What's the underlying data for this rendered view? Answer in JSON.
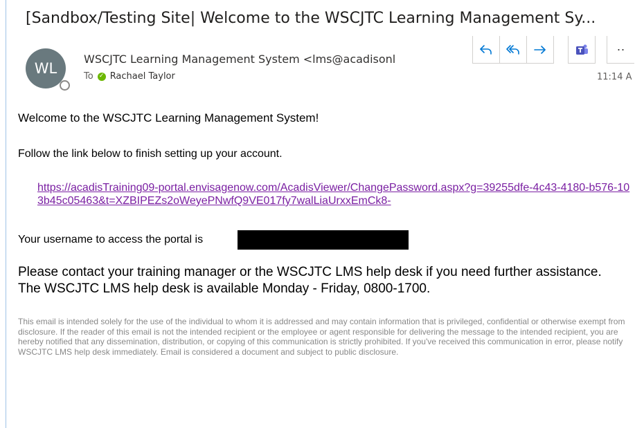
{
  "email": {
    "subject": "[Sandbox/Testing Site| Welcome to the WSCJTC Learning Management Sy...",
    "sender": {
      "initials": "WL",
      "display": "WSCJTC Learning Management System <lms@acadisonl"
    },
    "to_label": "To",
    "recipient": "Rachael Taylor",
    "time": "11:14 A",
    "actions": {
      "reply_icon": "reply-icon",
      "reply_all_icon": "reply-all-icon",
      "forward_icon": "forward-icon",
      "teams_icon": "teams-icon",
      "more_label": "··"
    },
    "body": {
      "welcome": "Welcome to the WSCJTC Learning Management System!",
      "follow": "Follow the link below to finish setting up your account.",
      "link": "https://acadisTraining09-portal.envisagenow.com/AcadisViewer/ChangePassword.aspx?g=39255dfe-4c43-4180-b576-103b45c05463&t=XZBIPEZs2oWeyePNwfQ9VE017fy7walLiaUrxxEmCk8-",
      "username_prefix": "Your username to access the portal is",
      "contact": "Please contact your training manager or the WSCJTC LMS help desk if you need further assistance. The WSCJTC LMS help desk is available Monday - Friday, 0800-1700.",
      "disclaimer": "This email is intended solely for the use of the individual to whom it is addressed and may contain information that is privileged, confidential or otherwise exempt from disclosure. If the reader of this email is not the intended recipient or the employee or agent responsible for delivering the message to the intended recipient, you are hereby notified that any dissemination, distribution, or copying of this communication is strictly prohibited. If you've received this communication in error, please notify WSCJTC LMS help desk immediately. Email is considered a document and subject to public disclosure."
    }
  },
  "colors": {
    "avatar_bg": "#69797e",
    "link": "#7a1fa2",
    "action_icon": "#0078d4",
    "teams": "#4b53bc",
    "presence_ok": "#6bb700",
    "disclaimer": "#888888"
  }
}
